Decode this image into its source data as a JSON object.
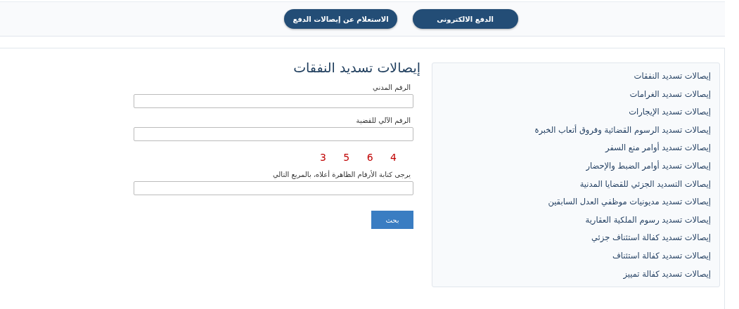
{
  "top_buttons": [
    {
      "label": "الدفع الالكترونى"
    },
    {
      "label": "الاستعلام عن إيصالات الدفع"
    }
  ],
  "form": {
    "title": "إيصالات تسديد النفقات",
    "fields": [
      {
        "label": "الرقم المدني"
      },
      {
        "label": "الرقم الآلي للقضية"
      }
    ],
    "captcha": "3 5 6 4",
    "captcha_field": {
      "label": "يرجى كتابة الأرقام الظاهرة أعلاه، بالمربع التالي"
    },
    "submit": "بحث"
  },
  "sidebar": {
    "items": [
      {
        "label": "إيصالات تسديد النفقات"
      },
      {
        "label": "إيصالات تسديد الغرامات"
      },
      {
        "label": "إيصالات تسديد الإيجارات"
      },
      {
        "label": "إيصالات تسديد الرسوم القضائية وفروق أتعاب الخبرة"
      },
      {
        "label": "إيصالات تسديد أوامر منع السفر"
      },
      {
        "label": "إيصالات تسديد أوامر الضبط والإحضار"
      },
      {
        "label": "إيصالات التسديد الجزئي للقضايا المدنية"
      },
      {
        "label": "إيصالات تسديد مديونيات موظفي العدل السابقين"
      },
      {
        "label": "إيصالات تسديد رسوم الملكية العقارية"
      },
      {
        "label": "إيصالات تسديد كفالة استئناف جزئي"
      },
      {
        "label": "إيصالات تسديد كفالة استئناف"
      },
      {
        "label": "إيصالات تسديد كفالة تمييز"
      }
    ]
  }
}
